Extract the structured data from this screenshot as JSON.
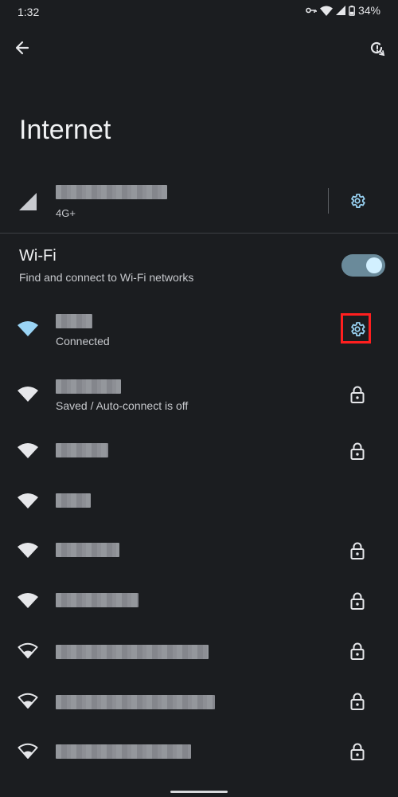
{
  "status_bar": {
    "time": "1:32",
    "battery": "34%"
  },
  "title": "Internet",
  "mobile": {
    "type": "4G+"
  },
  "wifi": {
    "title": "Wi-Fi",
    "subtitle": "Find and connect to Wi-Fi networks",
    "enabled": true
  },
  "networks": [
    {
      "status": "Connected",
      "action": "gear-icon",
      "secured": false
    },
    {
      "status": "Saved / Auto-connect is off",
      "action": "lock-icon",
      "secured": true
    },
    {
      "status": "",
      "action": "lock-icon",
      "secured": true
    },
    {
      "status": "",
      "action": "",
      "secured": false
    },
    {
      "status": "",
      "action": "lock-icon",
      "secured": true
    },
    {
      "status": "",
      "action": "lock-icon",
      "secured": true
    },
    {
      "status": "",
      "action": "lock-icon",
      "secured": true
    },
    {
      "status": "",
      "action": "lock-icon",
      "secured": true
    },
    {
      "status": "",
      "action": "lock-icon",
      "secured": true
    }
  ],
  "colors": {
    "background": "#1b1d20",
    "accent": "#9ad4f5",
    "highlight": "#ff1f1f"
  }
}
